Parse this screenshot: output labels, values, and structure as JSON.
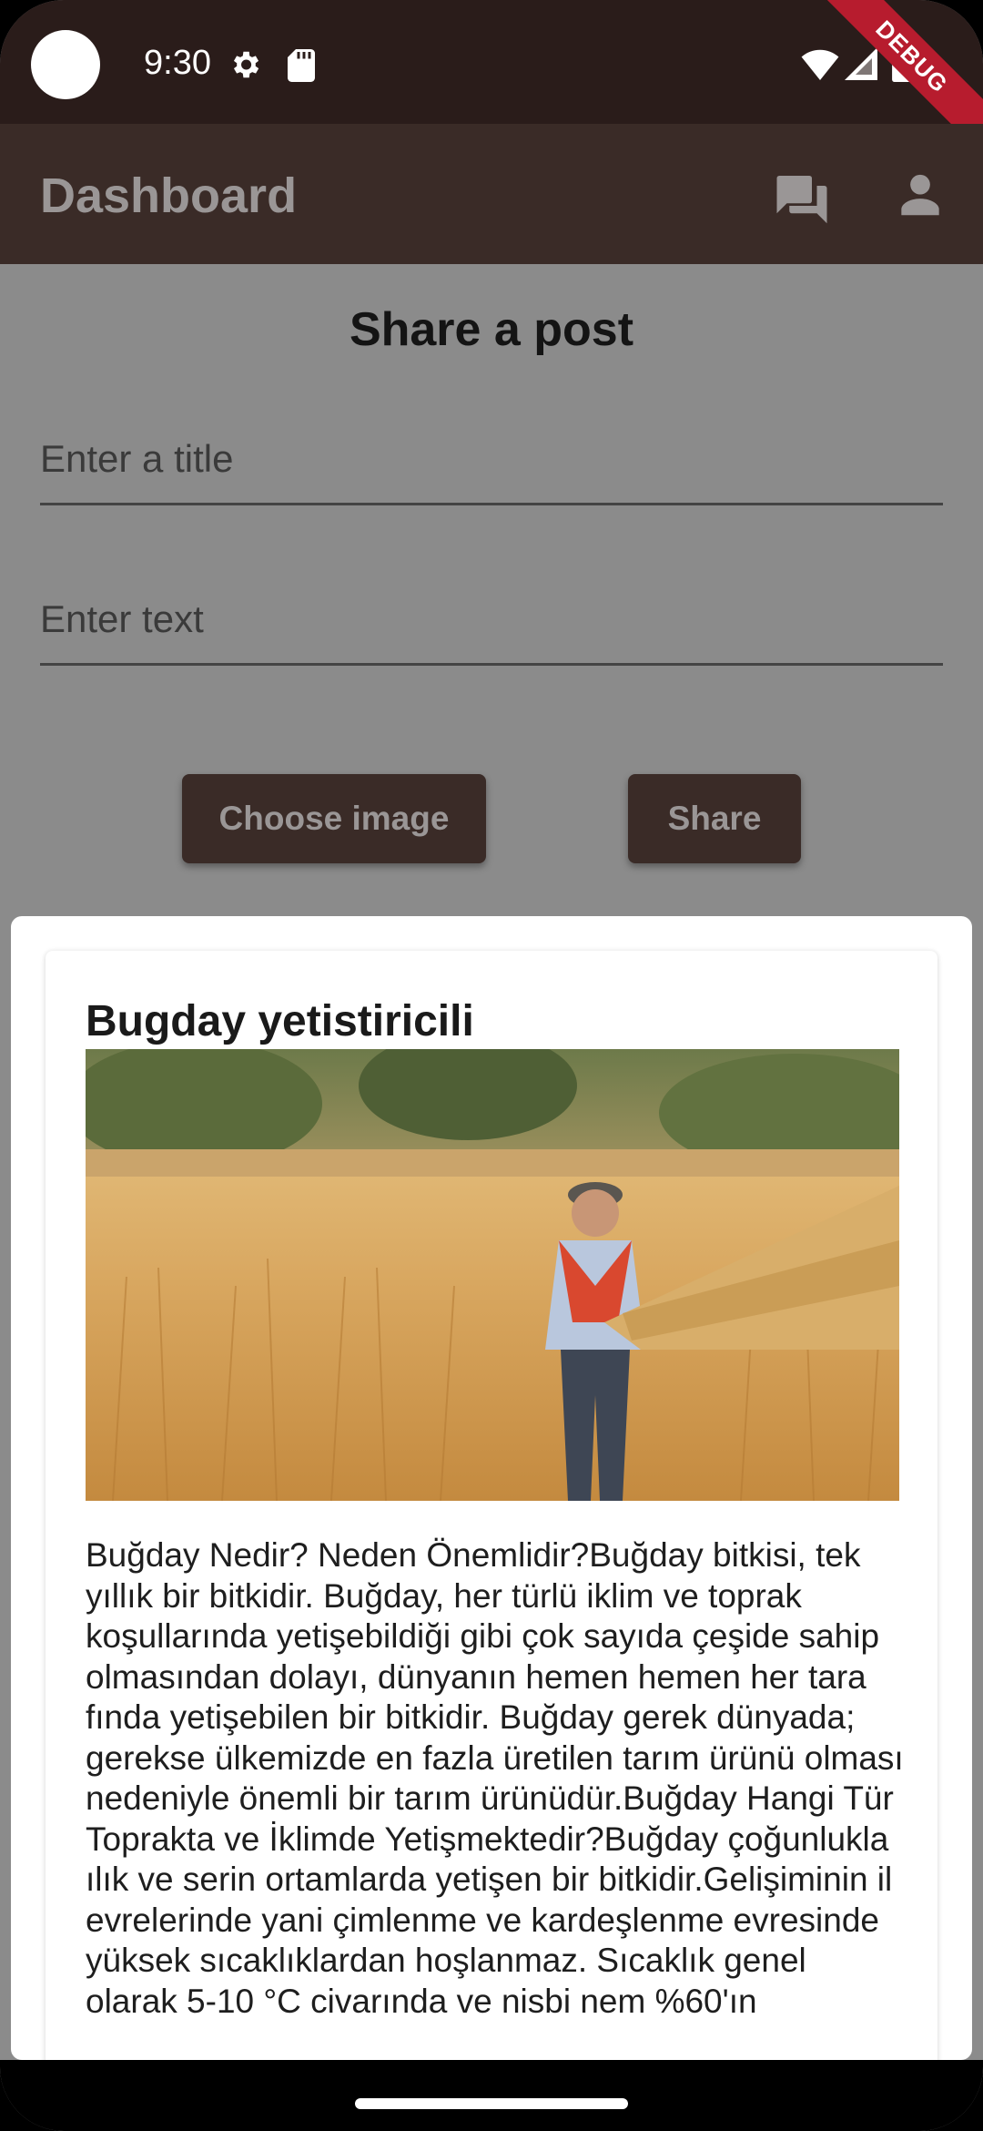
{
  "status_bar": {
    "time": "9:30",
    "icons": [
      "camera-cutout",
      "gear-icon",
      "sd-card-icon",
      "wifi-icon",
      "signal-icon",
      "battery-icon"
    ],
    "debug_label": "DEBUG"
  },
  "app_bar": {
    "title": "Dashboard",
    "actions": [
      "chat-icon",
      "person-icon"
    ]
  },
  "form": {
    "heading": "Share a post",
    "title_placeholder": "Enter a title",
    "text_placeholder": "Enter text",
    "choose_image_label": "Choose image",
    "share_label": "Share"
  },
  "post": {
    "title": "Bugday yetistiricili",
    "image_icon": "wheat-field-photo",
    "body": "Buğday Nedir? Neden Önemlidir?Buğday bitkisi, tek yıllık bir bitkidir. Buğday, her türlü iklim ve toprak koşullarında yetişebildiği gibi çok sayıda çeşide sahip olmasından dolayı, dünyanın hemen hemen her tara fında yetişebilen bir bitkidir. Buğday gerek dünyada; gerekse ülkemizde en fazla üretilen tarım ürünü olması nedeniyle önemli bir tarım ürünüdür.Buğday Hangi Tür Toprakta ve İklimde Yetişmektedir?Buğday çoğunlukla ılık ve serin ortamlarda yetişen bir bitkidir.Gelişiminin il evrelerinde yani çimlenme ve kardeşlenme evresinde yüksek sıcaklıklardan hoşlanmaz. Sıcaklık genel olarak 5-10 °C civarında ve nisbi nem %60'ın"
  },
  "colors": {
    "app_bar": "#3a2b27",
    "status_bar": "#2a1c1a",
    "scrim": "#8b8b8b",
    "debug": "#b71c2e"
  }
}
